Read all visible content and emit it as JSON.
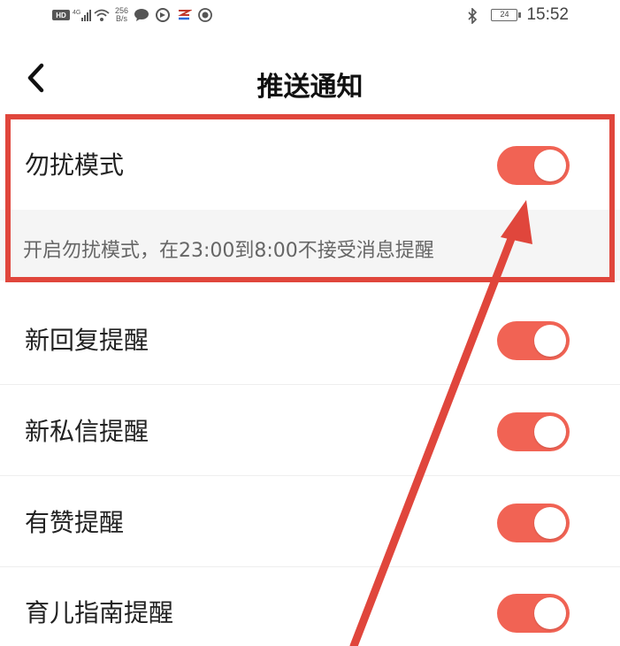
{
  "status_bar": {
    "speed_value": "256",
    "speed_unit": "B/s",
    "battery": "24",
    "time": "15:52",
    "icons": [
      "hd-icon",
      "signal-icon",
      "wifi-icon",
      "message-icon",
      "browser-icon",
      "app-icon",
      "app-icon-2",
      "bluetooth-icon"
    ]
  },
  "nav": {
    "title": "推送通知",
    "back_icon": "chevron-left-icon"
  },
  "settings": {
    "dnd": {
      "label": "勿扰模式",
      "on": true,
      "description": "开启勿扰模式，在23:00到8:00不接受消息提醒"
    },
    "items": [
      {
        "label": "新回复提醒",
        "on": true
      },
      {
        "label": "新私信提醒",
        "on": true
      },
      {
        "label": "有赞提醒",
        "on": true
      },
      {
        "label": "育儿指南提醒",
        "on": true
      }
    ]
  },
  "colors": {
    "toggle_on": "#f16354",
    "annotation": "#e0463c"
  }
}
